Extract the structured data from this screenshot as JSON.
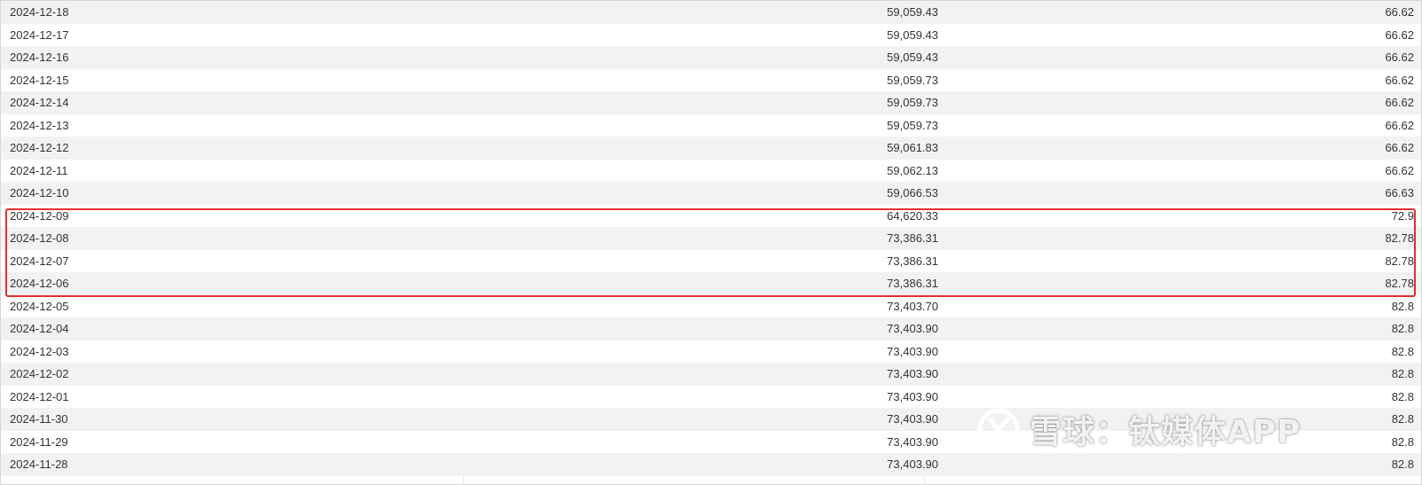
{
  "table": {
    "rows": [
      {
        "date": "2024-12-18",
        "value": "59,059.43",
        "percent": "66.62"
      },
      {
        "date": "2024-12-17",
        "value": "59,059.43",
        "percent": "66.62"
      },
      {
        "date": "2024-12-16",
        "value": "59,059.43",
        "percent": "66.62"
      },
      {
        "date": "2024-12-15",
        "value": "59,059.73",
        "percent": "66.62"
      },
      {
        "date": "2024-12-14",
        "value": "59,059.73",
        "percent": "66.62"
      },
      {
        "date": "2024-12-13",
        "value": "59,059.73",
        "percent": "66.62"
      },
      {
        "date": "2024-12-12",
        "value": "59,061.83",
        "percent": "66.62"
      },
      {
        "date": "2024-12-11",
        "value": "59,062.13",
        "percent": "66.62"
      },
      {
        "date": "2024-12-10",
        "value": "59,066.53",
        "percent": "66.63"
      },
      {
        "date": "2024-12-09",
        "value": "64,620.33",
        "percent": "72.9"
      },
      {
        "date": "2024-12-08",
        "value": "73,386.31",
        "percent": "82.78"
      },
      {
        "date": "2024-12-07",
        "value": "73,386.31",
        "percent": "82.78"
      },
      {
        "date": "2024-12-06",
        "value": "73,386.31",
        "percent": "82.78"
      },
      {
        "date": "2024-12-05",
        "value": "73,403.70",
        "percent": "82.8"
      },
      {
        "date": "2024-12-04",
        "value": "73,403.90",
        "percent": "82.8"
      },
      {
        "date": "2024-12-03",
        "value": "73,403.90",
        "percent": "82.8"
      },
      {
        "date": "2024-12-02",
        "value": "73,403.90",
        "percent": "82.8"
      },
      {
        "date": "2024-12-01",
        "value": "73,403.90",
        "percent": "82.8"
      },
      {
        "date": "2024-11-30",
        "value": "73,403.90",
        "percent": "82.8"
      },
      {
        "date": "2024-11-29",
        "value": "73,403.90",
        "percent": "82.8"
      },
      {
        "date": "2024-11-28",
        "value": "73,403.90",
        "percent": "82.8"
      }
    ],
    "highlighted_dates": [
      "2024-12-09",
      "2024-12-08",
      "2024-12-07",
      "2024-12-06"
    ]
  },
  "watermark": {
    "text": "雪球：钛媒体APP",
    "icon": "xueqiu-logo-icon"
  },
  "colors": {
    "highlight_border": "#e03030",
    "row_alt": "#f2f2f2",
    "text": "#333333"
  }
}
